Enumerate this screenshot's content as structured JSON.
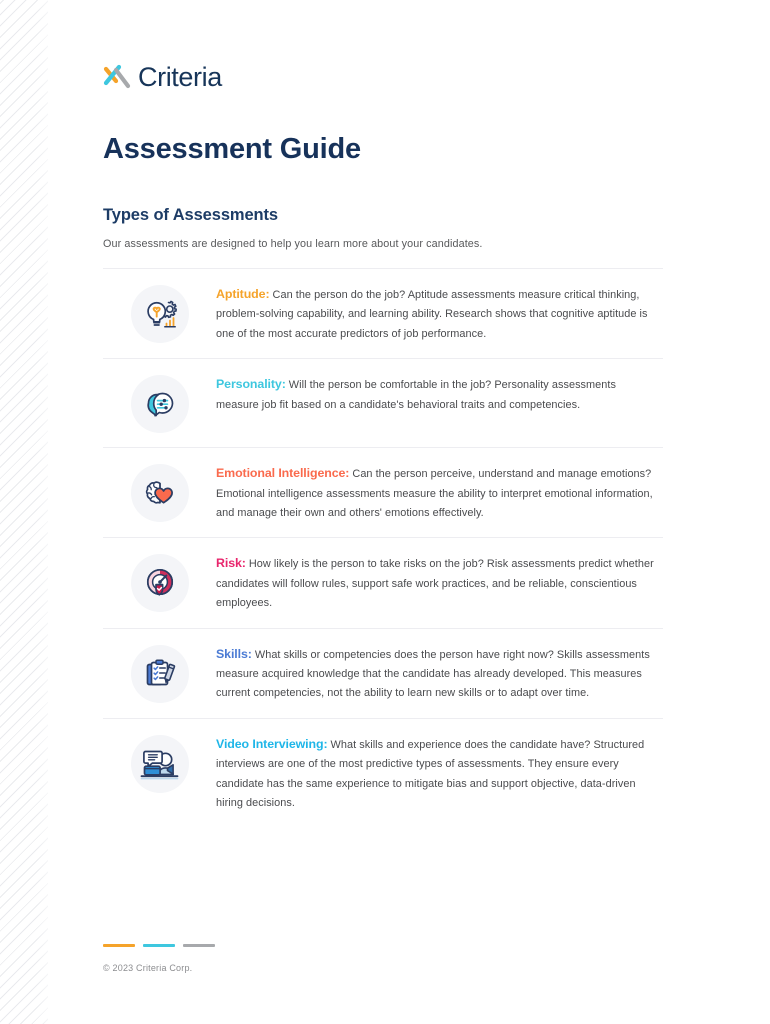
{
  "brand": {
    "logo_icon": "criteria-x-mark-icon",
    "logo_word": "Criteria",
    "logo_color_orange": "#f5a32a",
    "logo_color_teal": "#3ec7df",
    "logo_color_gray": "#a7a9ac",
    "logo_text_color": "#173559"
  },
  "header": {
    "doc_title": "Assessment Guide"
  },
  "section": {
    "title": "Types of Assessments",
    "subtitle": "Our assessments are designed to help you learn more about your candidates."
  },
  "assessment_types": [
    {
      "icon": "lightbulb-gear-icon",
      "label": "Aptitude:",
      "label_color": "#f5a32a",
      "body": " Can the person do the job? Aptitude assessments measure critical thinking, problem-solving capability, and learning ability. Research shows that cognitive aptitude is one of the most accurate predictors of job performance."
    },
    {
      "icon": "two-heads-profile-icon",
      "label": "Personality:",
      "label_color": "#3ec7df",
      "body": " Will the person be comfortable in the job? Personality assessments measure job fit based on a candidate's behavioral traits and competencies."
    },
    {
      "icon": "brain-heart-icon",
      "label": "Emotional Intelligence:",
      "label_color": "#fa6a4d",
      "body": " Can the person perceive, understand and manage emotions? Emotional intelligence assessments measure the ability to interpret emotional information, and manage their own and others' emotions effectively."
    },
    {
      "icon": "gauge-shield-icon",
      "label": "Risk:",
      "label_color": "#e8256c",
      "body": " How likely is the person to take risks on the job? Risk assessments predict whether candidates will follow rules, support safe work practices, and be reliable, conscientious employees."
    },
    {
      "icon": "clipboard-checklist-pencil-icon",
      "label": "Skills:",
      "label_color": "#4b7bd4",
      "body": " What skills or competencies does the person have right now? Skills assessments measure acquired knowledge that the candidate has already developed. This measures current competencies, not the ability to learn new skills or to adapt over time."
    },
    {
      "icon": "video-interview-desk-icon",
      "label": "Video Interviewing:",
      "label_color": "#1fb6e8",
      "body": " What skills and experience does the candidate have? Structured interviews are one of the most predictive types of assessments. They ensure every candidate has the same experience to mitigate bias and support objective, data-driven hiring decisions."
    }
  ],
  "footer": {
    "bar_colors": [
      "#f5a32a",
      "#3ec7df",
      "#a7a9ac"
    ],
    "copyright": "© 2023 Criteria Corp."
  }
}
